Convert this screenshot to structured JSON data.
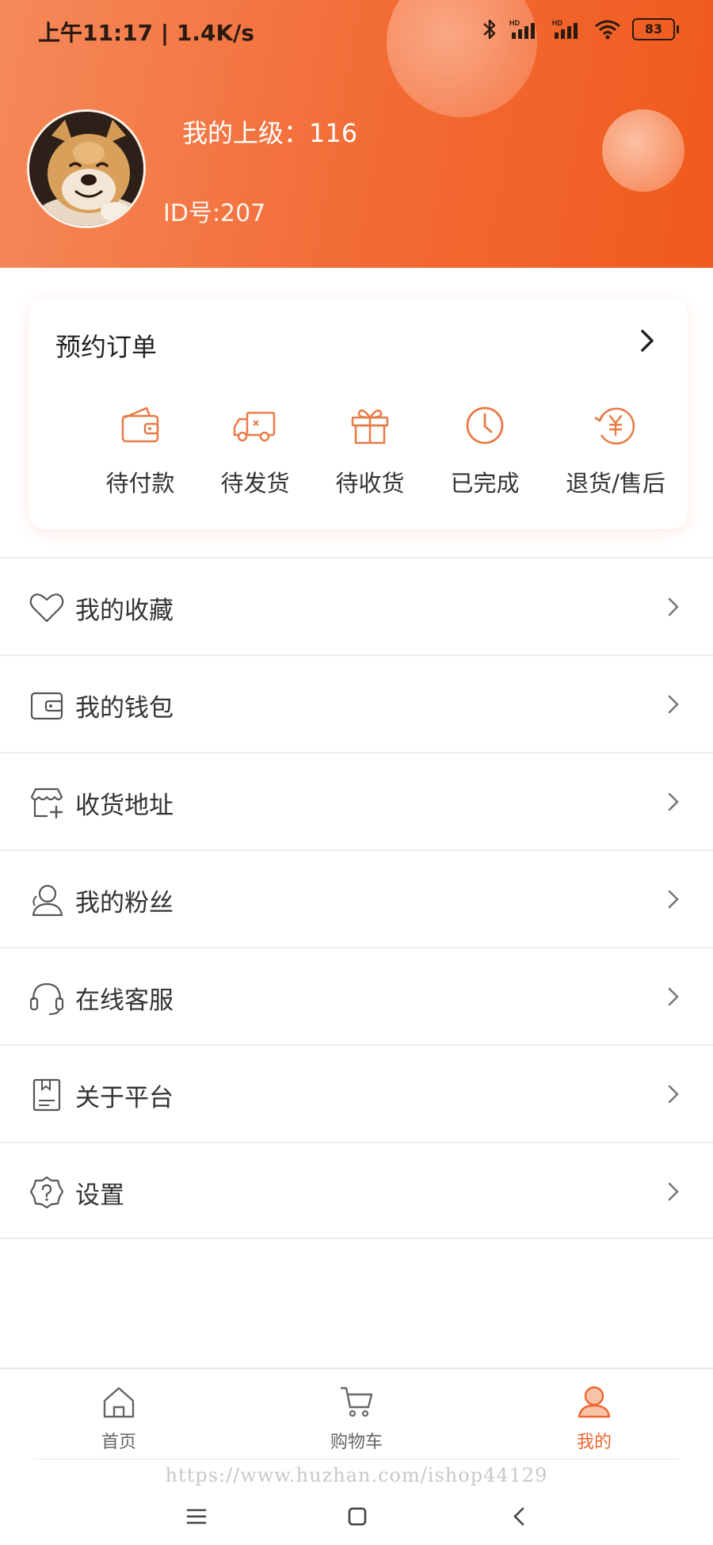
{
  "status_bar": {
    "time": "上午11:17 | 1.4K/s",
    "battery": "83",
    "network": "HD"
  },
  "profile": {
    "superior": "我的上级：116",
    "id": "ID号:207"
  },
  "orders": {
    "title": "预约订单",
    "items": [
      {
        "label": "待付款",
        "icon": "wallet-icon"
      },
      {
        "label": "待发货",
        "icon": "truck-icon"
      },
      {
        "label": "待收货",
        "icon": "gift-icon"
      },
      {
        "label": "已完成",
        "icon": "clock-icon"
      },
      {
        "label": "退货/售后",
        "icon": "refund-yuan-icon"
      }
    ]
  },
  "menu": {
    "items": [
      {
        "label": "我的收藏",
        "icon": "heart-icon"
      },
      {
        "label": "我的钱包",
        "icon": "wallet-icon"
      },
      {
        "label": "收货地址",
        "icon": "store-add-icon"
      },
      {
        "label": "我的粉丝",
        "icon": "users-icon"
      },
      {
        "label": "在线客服",
        "icon": "headset-icon"
      },
      {
        "label": "关于平台",
        "icon": "document-icon"
      },
      {
        "label": "设置",
        "icon": "settings-icon"
      }
    ]
  },
  "nav": {
    "items": [
      {
        "label": "首页",
        "icon": "home-icon"
      },
      {
        "label": "购物车",
        "icon": "cart-icon"
      },
      {
        "label": "我的",
        "icon": "user-icon",
        "active": true
      }
    ]
  },
  "watermark": "https://www.huzhan.com/ishop44129",
  "colors": {
    "accent": "#f0662e",
    "header_start": "#f5895a",
    "header_end": "#f05a1d",
    "icon_orange": "#e87a45"
  }
}
